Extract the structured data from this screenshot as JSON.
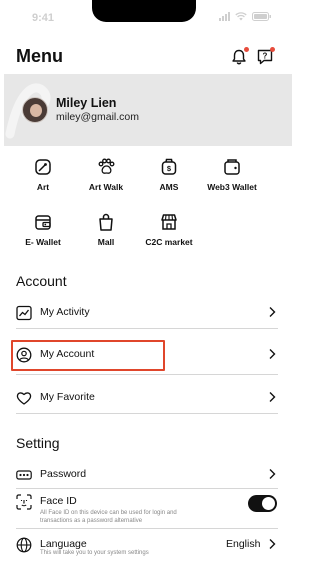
{
  "status_bar": {
    "time": "9:41"
  },
  "header": {
    "title": "Menu",
    "notification_icon": "bell-icon",
    "help_icon": "help-chat-icon",
    "badge_color": "#e74c3c"
  },
  "profile": {
    "name": "Miley Lien",
    "email": "miley@gmail.com"
  },
  "shortcuts": [
    {
      "label": "Art",
      "icon": "art-tag-icon"
    },
    {
      "label": "Art Walk",
      "icon": "paw-icon"
    },
    {
      "label": "AMS",
      "icon": "money-bag-icon"
    },
    {
      "label": "Web3 Wallet",
      "icon": "wallet-icon"
    },
    {
      "label": "E- Wallet",
      "icon": "e-wallet-icon"
    },
    {
      "label": "Mall",
      "icon": "shopping-bag-icon"
    },
    {
      "label": "C2C market",
      "icon": "storefront-icon"
    }
  ],
  "account": {
    "title": "Account",
    "items": [
      {
        "label": "My Activity",
        "icon": "activity-chart-icon"
      },
      {
        "label": "My Account",
        "icon": "user-circle-icon"
      },
      {
        "label": "My Favorite",
        "icon": "heart-icon"
      }
    ]
  },
  "setting": {
    "title": "Setting",
    "password": {
      "label": "Password",
      "icon": "password-dots-icon"
    },
    "face_id": {
      "label": "Face ID",
      "description": "All Face ID on this device can be used for login and transactions as a password alternative",
      "enabled": true
    },
    "language": {
      "label": "Language",
      "value": "English",
      "description": "This will take you to your system settings",
      "icon": "globe-icon"
    }
  },
  "highlight_color": "#e0462b"
}
